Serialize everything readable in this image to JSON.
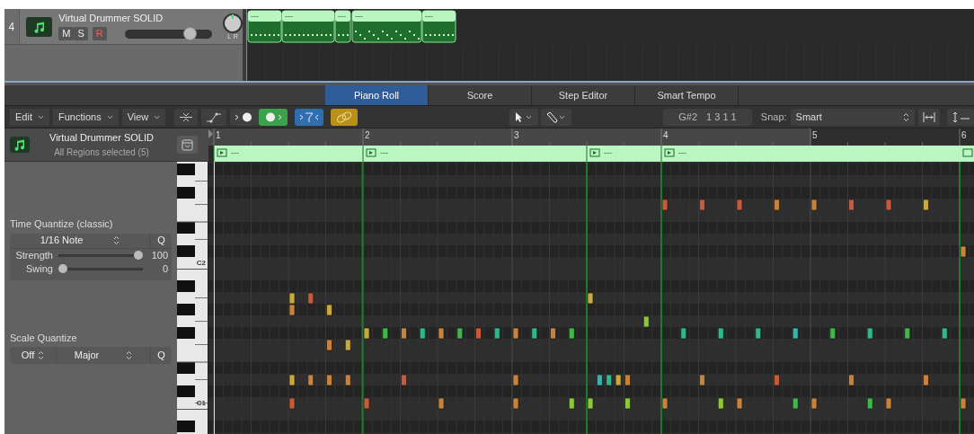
{
  "track": {
    "number": "4",
    "name": "Virtual Drummer SOLID",
    "buttons": [
      {
        "label": "M",
        "kind": "mute"
      },
      {
        "label": "S",
        "kind": "solo"
      },
      {
        "label": "R",
        "kind": "record"
      }
    ],
    "volume": {
      "level": 0.74
    },
    "pan_labels": [
      "L",
      "R"
    ],
    "regions": [
      {
        "label": "---"
      },
      {
        "label": "---"
      },
      {
        "label": "---"
      },
      {
        "label": "---"
      },
      {
        "label": "---"
      }
    ]
  },
  "tabs": [
    {
      "label": "Piano Roll",
      "selected": true
    },
    {
      "label": "Score",
      "selected": false
    },
    {
      "label": "Step Editor",
      "selected": false
    },
    {
      "label": "Smart Tempo",
      "selected": false
    }
  ],
  "toolbar": {
    "menus": [
      "Edit",
      "Functions",
      "View"
    ],
    "toggles": [
      {
        "kind": "midi-in",
        "on": false
      },
      {
        "kind": "midi-out",
        "on": true
      },
      {
        "kind": "catch",
        "on": true
      },
      {
        "kind": "link",
        "on": true
      }
    ],
    "pitch": "G#2",
    "position": "1 3 1 1",
    "snap_label": "Snap:",
    "snap_value": "Smart"
  },
  "inspector": {
    "name": "Virtual Drummer SOLID",
    "subtitle": "All Regions selected (5)",
    "time_quantize": {
      "title": "Time Quantize (classic)",
      "value": "1/16 Note",
      "button": "Q",
      "sliders": [
        {
          "label": "Strength",
          "level": 1,
          "reading": "100"
        },
        {
          "label": "Swing",
          "level": 0,
          "reading": "0"
        }
      ]
    },
    "scale_quantize": {
      "title": "Scale Quantize",
      "root": "Off",
      "scale": "Major",
      "button": "Q"
    }
  },
  "piano": {
    "octave_labels": [
      "C2",
      "C1"
    ]
  },
  "ruler": {
    "bars": [
      "1",
      "2",
      "3",
      "4",
      "5",
      "6"
    ]
  },
  "editor_regions": [
    {
      "label": "---"
    },
    {
      "label": "---"
    },
    {
      "label": "---"
    },
    {
      "label": "---"
    }
  ]
}
